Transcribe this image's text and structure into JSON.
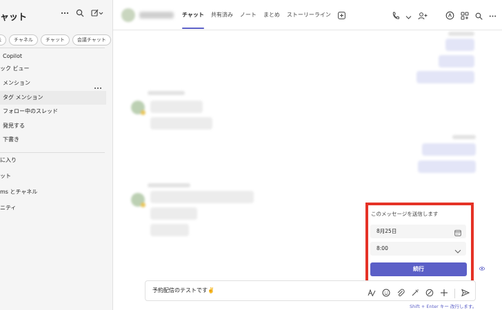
{
  "sidebar": {
    "title": "ャット",
    "filters": [
      "未",
      "チャネル",
      "チャット",
      "会議チャット"
    ],
    "items": [
      {
        "label": "Copilot"
      },
      {
        "label": "ック ビュー"
      },
      {
        "label": "メンション"
      },
      {
        "label": "タグ メンション"
      },
      {
        "label": "フォロー中のスレッド"
      },
      {
        "label": "発見する"
      },
      {
        "label": "下書き"
      },
      {
        "label": "に入り"
      },
      {
        "label": "ット"
      },
      {
        "label": "ms とチャネル"
      },
      {
        "label": "ニティ"
      }
    ]
  },
  "header": {
    "tabs": [
      {
        "label": "チャット"
      },
      {
        "label": "共有済み"
      },
      {
        "label": "ノート"
      },
      {
        "label": "まとめ"
      },
      {
        "label": "ストーリーライン"
      }
    ]
  },
  "schedule_popup": {
    "title": "このメッセージを送信します",
    "date": "8月25日",
    "time": "8:00",
    "continue_label": "続行"
  },
  "compose": {
    "text": "予約配信のテストです✌️",
    "hint": "Shift + Enter キー 改行します。"
  },
  "colors": {
    "accent": "#5b5fc7",
    "highlight": "#e53226",
    "sidebar_bg": "#f5f5f5"
  }
}
